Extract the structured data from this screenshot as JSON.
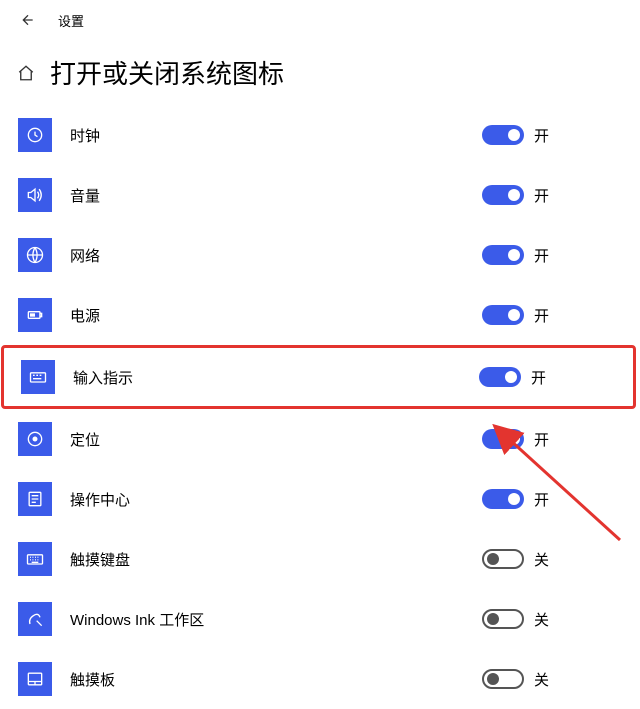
{
  "header": {
    "app_title": "设置"
  },
  "page": {
    "title": "打开或关闭系统图标"
  },
  "labels": {
    "on": "开",
    "off": "关"
  },
  "items": [
    {
      "icon": "clock",
      "label": "时钟",
      "on": true,
      "highlight": false
    },
    {
      "icon": "volume",
      "label": "音量",
      "on": true,
      "highlight": false
    },
    {
      "icon": "network",
      "label": "网络",
      "on": true,
      "highlight": false
    },
    {
      "icon": "battery",
      "label": "电源",
      "on": true,
      "highlight": false
    },
    {
      "icon": "input",
      "label": "输入指示",
      "on": true,
      "highlight": true
    },
    {
      "icon": "location",
      "label": "定位",
      "on": true,
      "highlight": false
    },
    {
      "icon": "action",
      "label": "操作中心",
      "on": true,
      "highlight": false
    },
    {
      "icon": "keyboard",
      "label": "触摸键盘",
      "on": false,
      "highlight": false
    },
    {
      "icon": "ink",
      "label": "Windows Ink 工作区",
      "on": false,
      "highlight": false
    },
    {
      "icon": "touchpad",
      "label": "触摸板",
      "on": false,
      "highlight": false
    }
  ]
}
